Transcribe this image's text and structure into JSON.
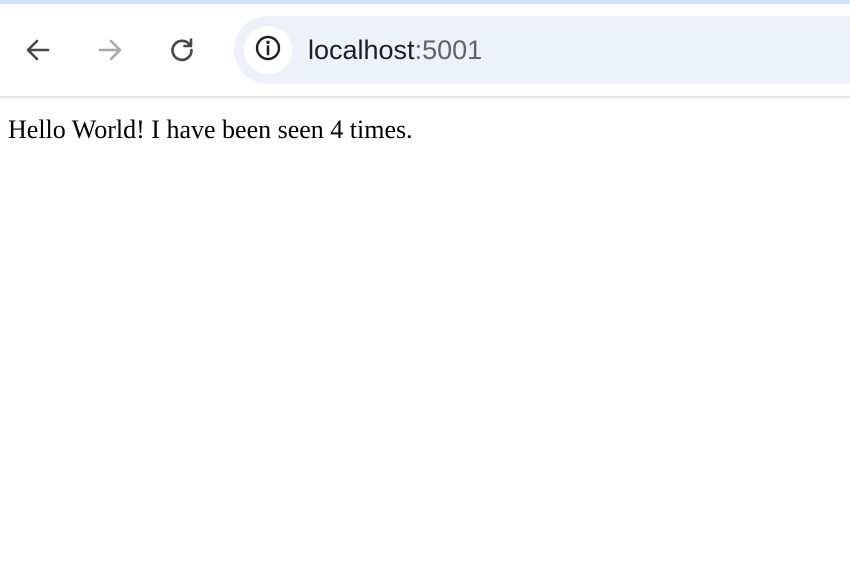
{
  "browser": {
    "toolbar": {
      "back_icon": "arrow-left-icon",
      "forward_icon": "arrow-right-icon",
      "reload_icon": "reload-icon",
      "forward_enabled": false
    },
    "omnibox": {
      "site_info_icon": "info-circle-icon",
      "url_host": "localhost",
      "url_port": ":5001"
    }
  },
  "page": {
    "message": "Hello World! I have been seen 4 times."
  },
  "colors": {
    "top_strip": "#d3e3fd",
    "omnibox_bg": "#edf1f9",
    "icon_active": "#474747",
    "icon_disabled": "#a8a8a8"
  }
}
